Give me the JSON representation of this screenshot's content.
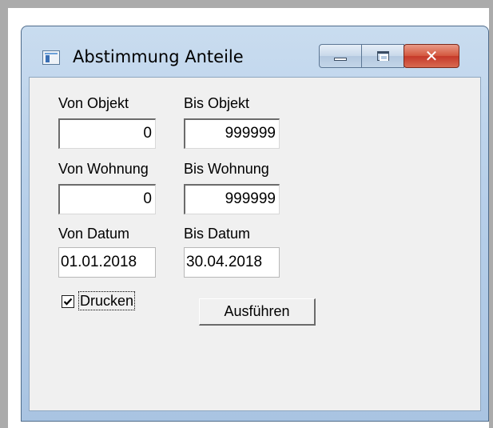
{
  "window": {
    "title": "Abstimmung Anteile",
    "close_glyph": "✕"
  },
  "form": {
    "von_objekt": {
      "label": "Von Objekt",
      "value": "0"
    },
    "bis_objekt": {
      "label": "Bis Objekt",
      "value": "999999"
    },
    "von_wohnung": {
      "label": "Von Wohnung",
      "value": "0"
    },
    "bis_wohnung": {
      "label": "Bis Wohnung",
      "value": "999999"
    },
    "von_datum": {
      "label": "Von Datum",
      "value": "01.01.2018"
    },
    "bis_datum": {
      "label": "Bis Datum",
      "value": "30.04.2018"
    },
    "drucken": {
      "label": "Drucken",
      "checked": true
    },
    "execute_label": "Ausführen"
  },
  "colors": {
    "title_bar": "#b8d0ea",
    "close_button": "#c5392a",
    "client_background": "#f0f0f0"
  },
  "icons": [
    "app-window-icon",
    "minimize-icon",
    "maximize-icon",
    "close-icon",
    "checkmark-icon"
  ]
}
